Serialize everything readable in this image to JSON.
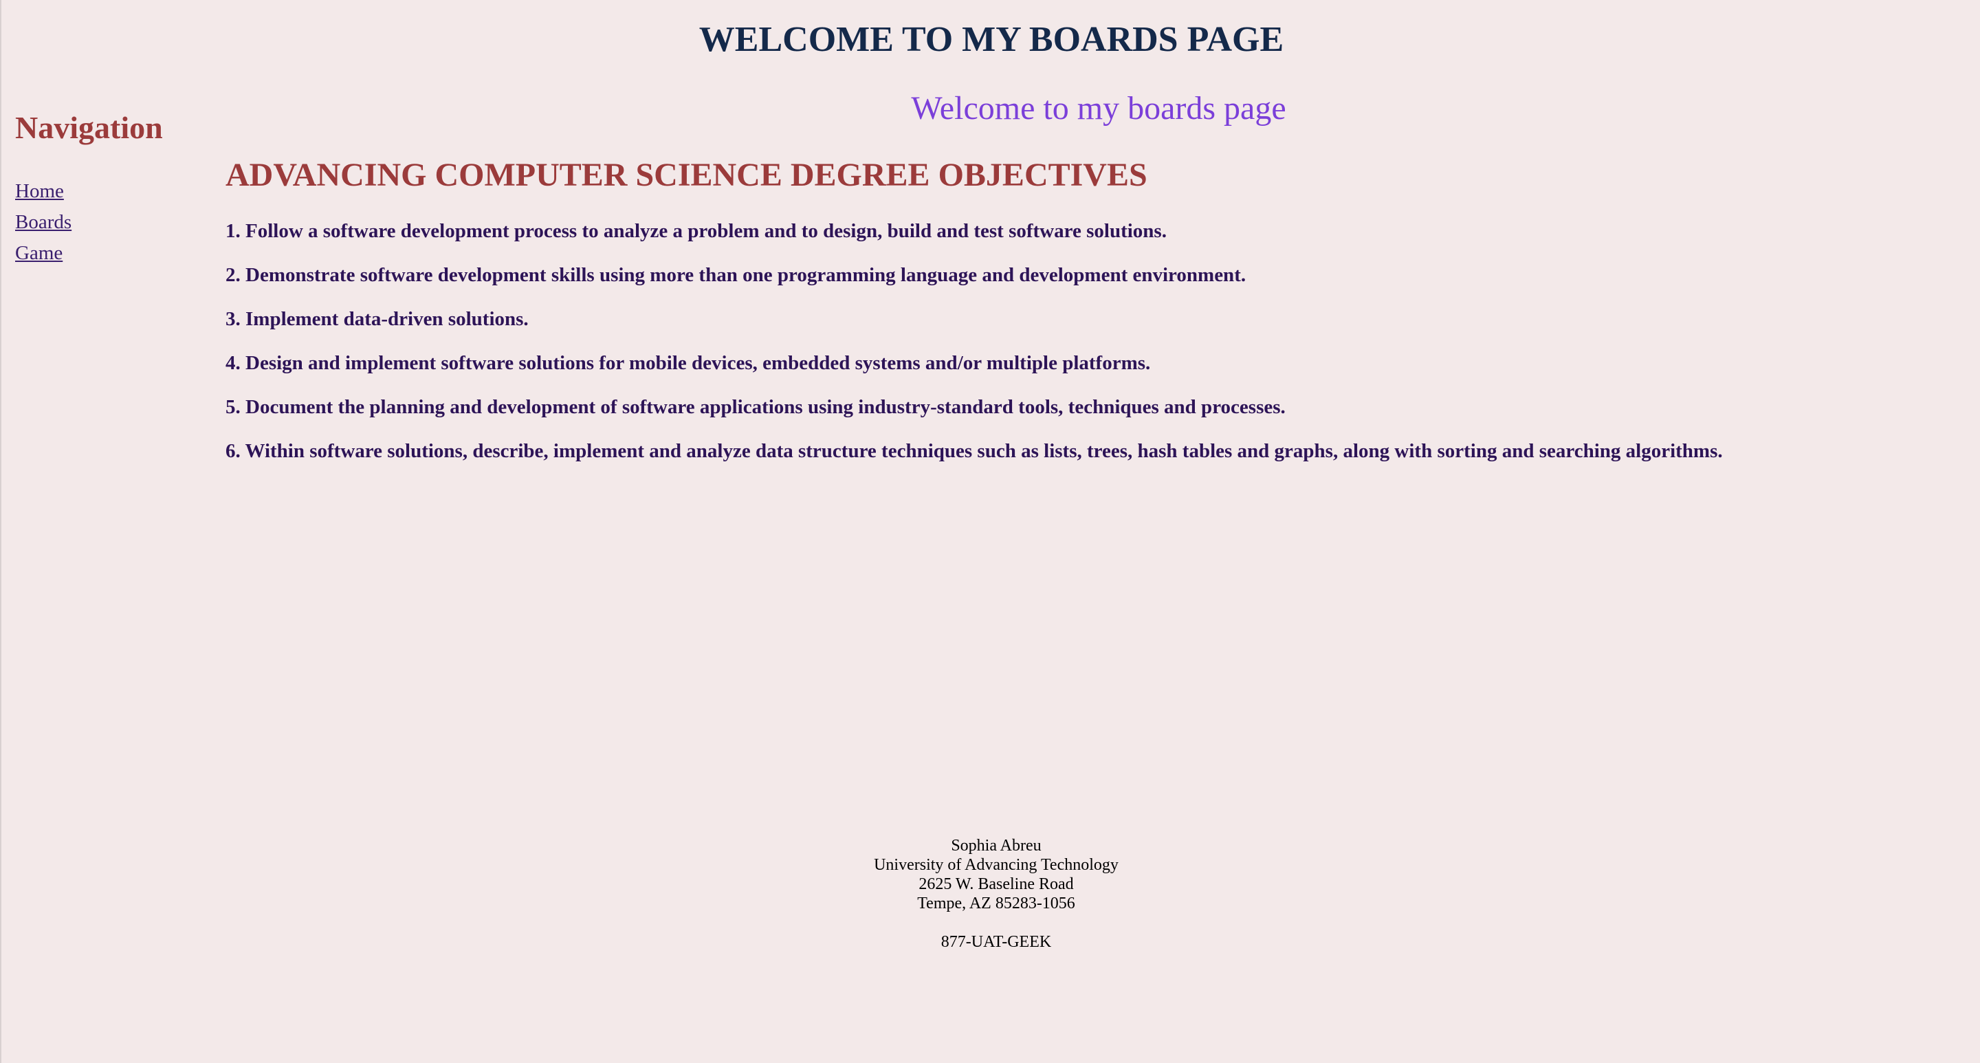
{
  "header": {
    "title": "WELCOME TO MY BOARDS PAGE"
  },
  "sidebar": {
    "heading": "Navigation",
    "items": [
      {
        "label": "Home"
      },
      {
        "label": "Boards"
      },
      {
        "label": "Game"
      }
    ]
  },
  "main": {
    "subtitle": "Welcome to my boards page",
    "section_heading": "ADVANCING COMPUTER SCIENCE DEGREE OBJECTIVES",
    "objectives": [
      "1. Follow a software development process to analyze a problem and to design, build and test software solutions.",
      "2. Demonstrate software development skills using more than one programming language and development environment.",
      "3. Implement data-driven solutions.",
      "4. Design and implement software solutions for mobile devices, embedded systems and/or multiple platforms.",
      "5. Document the planning and development of software applications using industry-standard tools, techniques and processes.",
      "6. Within software solutions, describe, implement and analyze data structure techniques such as lists, trees, hash tables and graphs, along with sorting and searching algorithms."
    ]
  },
  "footer": {
    "name": "Sophia Abreu",
    "institution": "University of Advancing Technology",
    "street": "2625 W. Baseline Road",
    "city": "Tempe, AZ 85283-1056",
    "phone": "877-UAT-GEEK"
  },
  "colors": {
    "background": "#f3e9e9",
    "title": "#14294a",
    "heading": "#9b3b3b",
    "subtitle": "#7b3fd9",
    "body_text": "#2d1457"
  }
}
